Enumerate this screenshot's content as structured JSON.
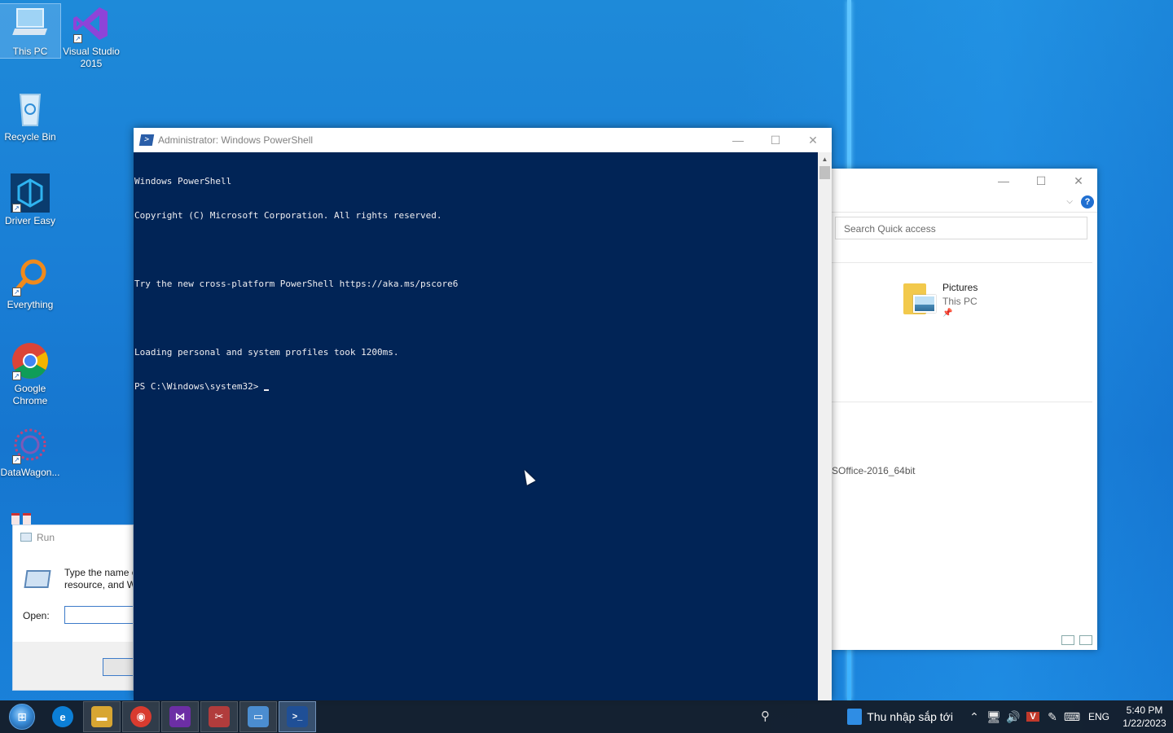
{
  "desktop": {
    "icons": [
      {
        "label": "This PC",
        "icon": "computer-icon"
      },
      {
        "label": "Visual Studio 2015",
        "icon": "visual-studio-icon"
      },
      {
        "label": "Recycle Bin",
        "icon": "recycle-bin-icon"
      },
      {
        "label": "Driver Easy",
        "icon": "driver-easy-icon"
      },
      {
        "label": "Everything",
        "icon": "everything-search-icon"
      },
      {
        "label": "Google Chrome",
        "icon": "chrome-icon"
      },
      {
        "label": "DataWagon...",
        "icon": "datawagon-icon"
      }
    ]
  },
  "powershell": {
    "title": "Administrator: Windows PowerShell",
    "lines": [
      "Windows PowerShell",
      "Copyright (C) Microsoft Corporation. All rights reserved.",
      "",
      "Try the new cross-platform PowerShell https://aka.ms/pscore6",
      "",
      "Loading personal and system profiles took 1200ms.",
      "PS C:\\Windows\\system32> "
    ],
    "buttons": {
      "minimize": "—",
      "maximize": "☐",
      "close": "✕"
    },
    "colors": {
      "background": "#012456",
      "text": "#eeedf0"
    }
  },
  "explorer": {
    "search_placeholder": "Search Quick access",
    "quick_access": {
      "name": "Pictures",
      "location": "This PC",
      "pin": "📌"
    },
    "recent_file": "SOffice-2016_64bit",
    "buttons": {
      "minimize": "—",
      "maximize": "☐",
      "close": "✕",
      "help": "?",
      "expand": "⌵"
    }
  },
  "run_dialog": {
    "title": "Run",
    "description_line1": "Type the name o",
    "description_line2": "resource, and W",
    "open_label": "Open:",
    "open_value": ""
  },
  "taskbar": {
    "start": "⊞",
    "apps": [
      {
        "name": "Microsoft Edge",
        "icon": "edge-icon",
        "glyph": "e",
        "color": "#0c7fd6"
      },
      {
        "name": "File Explorer",
        "icon": "folder-icon",
        "glyph": "▬",
        "color": "#d8a632"
      },
      {
        "name": "Google Chrome",
        "icon": "chrome-icon",
        "glyph": "◉",
        "color": "#d93b2f"
      },
      {
        "name": "Visual Studio",
        "icon": "visual-studio-icon",
        "glyph": "⋈",
        "color": "#6c2ea5"
      },
      {
        "name": "Snipping",
        "icon": "tool-icon",
        "glyph": "✂",
        "color": "#b13c3c"
      },
      {
        "name": "Run",
        "icon": "run-icon",
        "glyph": "▭",
        "color": "#4b8dd0"
      },
      {
        "name": "Windows PowerShell",
        "icon": "powershell-icon",
        "glyph": ">_",
        "color": "#1f4f96"
      }
    ],
    "weather_text": "Thu nhập sắp tới",
    "tray_icons": [
      "⌃",
      "🖥",
      "🔊",
      "V",
      "✎",
      "⌨"
    ],
    "language": "ENG",
    "time": "5:40 PM",
    "date": "1/22/2023"
  }
}
